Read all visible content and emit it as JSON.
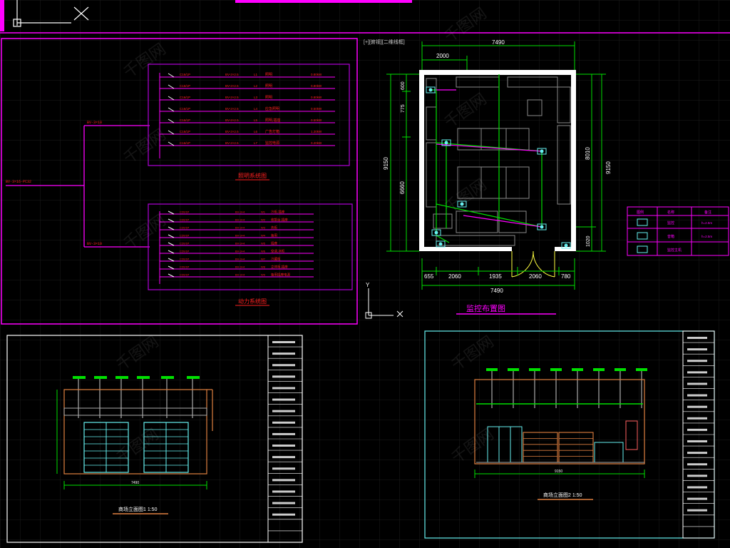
{
  "colors": {
    "background": "#000000",
    "grid": "#1c1c1c",
    "magenta": "#ff00ff",
    "purple": "#b000d8",
    "red": "#ff2020",
    "white": "#ffffff",
    "green": "#00e000",
    "cyan": "#66f0f0",
    "orange": "#e08040",
    "yellow": "#ffff40"
  },
  "panels": {
    "electrical": {
      "lighting_caption": "照明系统图",
      "power_caption": "动力系统图",
      "feeder_label": "BV-3×16-PC32",
      "branch_label_1": "BV-3×10",
      "branch_label_2": "BV-3×10",
      "lighting_rows": [
        {
          "breaker": "C16/1P",
          "cable": "BV-2×2.5",
          "circuit": "L1",
          "load": "照明",
          "power": "0.80kW"
        },
        {
          "breaker": "C16/1P",
          "cable": "BV-2×2.5",
          "circuit": "L2",
          "load": "照明",
          "power": "0.80kW"
        },
        {
          "breaker": "C16/1P",
          "cable": "BV-2×2.5",
          "circuit": "L3",
          "load": "照明",
          "power": "0.80kW"
        },
        {
          "breaker": "C16/1P",
          "cable": "BV-2×2.5",
          "circuit": "L4",
          "load": "应急照明",
          "power": "0.50kW"
        },
        {
          "breaker": "C16/1P",
          "cable": "BV-2×2.5",
          "circuit": "L5",
          "load": "照明,插座 ",
          "power": "0.50kW"
        },
        {
          "breaker": "C16/1P",
          "cable": "BV-2×2.5",
          "circuit": "L6",
          "load": "广告灯箱",
          "power": "1.20kW"
        },
        {
          "breaker": "C16/1P",
          "cable": "BV-2×2.5",
          "circuit": "L7",
          "load": "监控电源",
          "power": "0.20kW"
        }
      ],
      "power_rows": [
        {
          "breaker": "C20/1P",
          "cable": "BV-3×4",
          "circuit": "W1",
          "load": "冷柜,插座"
        },
        {
          "breaker": "C20/1P",
          "cable": "BV-3×4",
          "circuit": "W2",
          "load": "收银台,插座"
        },
        {
          "breaker": "C20/1P",
          "cable": "BV-3×4",
          "circuit": "W3",
          "load": "热柜"
        },
        {
          "breaker": "C20/1P",
          "cable": "BV-3×4",
          "circuit": "W4",
          "load": "备用"
        },
        {
          "breaker": "C20/1P",
          "cable": "BV-3×4",
          "circuit": "W5",
          "load": "插座"
        },
        {
          "breaker": "C20/1P",
          "cable": "BV-3×4",
          "circuit": "W6",
          "load": "空调,冰柜"
        },
        {
          "breaker": "C20/1P",
          "cable": "BV-3×4",
          "circuit": "W7",
          "load": "冷藏柜"
        },
        {
          "breaker": "C20/1P",
          "cable": "BV-3×4",
          "circuit": "W8",
          "load": "立体柜,插座"
        },
        {
          "breaker": "C20/1P",
          "cable": "BV-3×4",
          "circuit": "W9",
          "load": "备用插座电源"
        }
      ]
    },
    "plan": {
      "title": "[+][俯视][二维线框]",
      "caption": "监控布置图",
      "dim_top_total": "7490",
      "dim_top_left": "2000",
      "dim_bottom": [
        "655",
        "2060",
        "1935",
        "2060",
        "780"
      ],
      "dim_bottom_total": "7490",
      "dim_left_total": "9150",
      "dim_left_parts": [
        "600",
        "775",
        "6660"
      ],
      "dim_right_total": "9150",
      "dim_right_upper": "8010",
      "dim_right_lower": "1020",
      "ucs_y": "Y",
      "ucs_x": "X",
      "legend_headers": [
        "图例",
        "名称",
        "备注"
      ],
      "legend_rows": [
        {
          "name": "监控",
          "note": "h=2.5m"
        },
        {
          "name": "音箱",
          "note": "h=2.5m"
        },
        {
          "name": "监控主机",
          "note": ""
        }
      ]
    },
    "elevation_left": {
      "caption": "商场立面图1 1:50",
      "dim": "7490"
    },
    "elevation_right": {
      "caption": "商场立面图2 1:50",
      "dim": "9150"
    }
  },
  "watermark": "千图网"
}
